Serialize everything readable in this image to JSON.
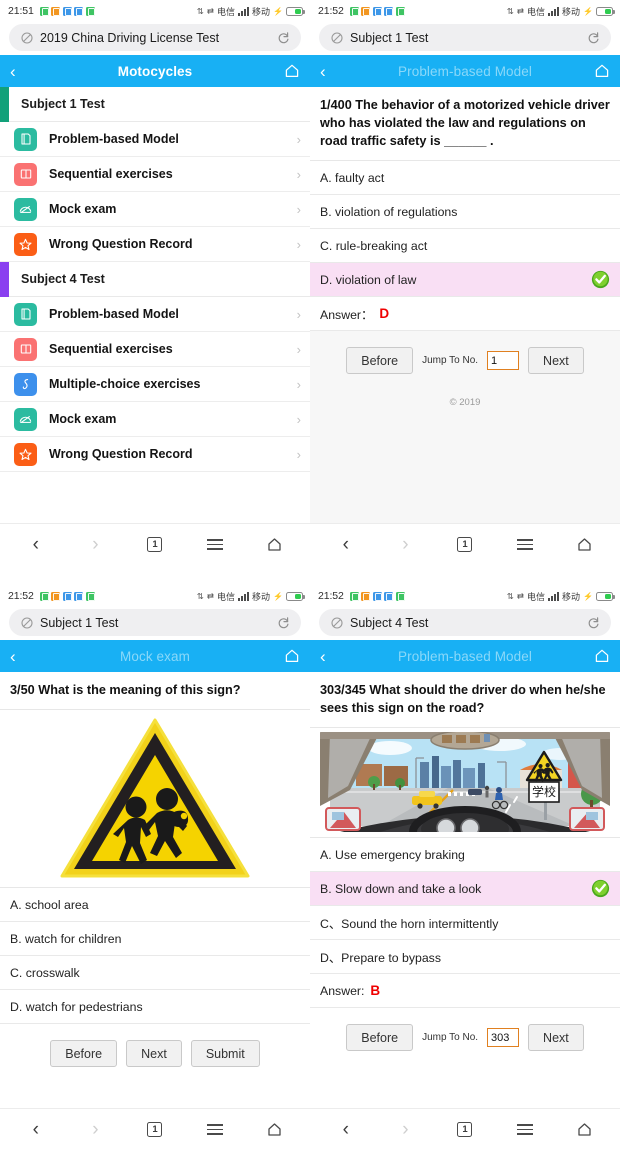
{
  "statusbar": {
    "time_1": "21:51",
    "time_2": "21:52",
    "carrier_left": "电信",
    "carrier_right": "移动",
    "app_badge_colors": [
      "#3ec463",
      "#f29620",
      "#3d97e8",
      "#3d97e8",
      "#3ec463"
    ],
    "battery_color": "#2fcc4f"
  },
  "theme": {
    "header_blue": "#18b0f4",
    "header_title_faded": "#8ad8f9",
    "correct_row_pink": "#f9dff4",
    "answer_red": "#ef0000",
    "input_border_orange": "#e08020",
    "subject1_accent": "#12a17a",
    "subject4_accent": "#8a3ff0"
  },
  "panels": [
    {
      "id": "panel-menu",
      "url_bar": {
        "value": "2019 China Driving License Test",
        "left_icon": "no-security-icon",
        "right_icon": "reload-icon"
      },
      "header": {
        "title": "Motocycles",
        "faded": false
      },
      "sections": [
        {
          "title": "Subject 1 Test",
          "accent": "#12a17a",
          "items": [
            {
              "label": "Problem-based Model",
              "icon": "book-stack-icon",
              "color": "#2bbba0"
            },
            {
              "label": "Sequential exercises",
              "icon": "open-book-icon",
              "color": "#fa7272"
            },
            {
              "label": "Mock exam",
              "icon": "gauge-icon",
              "color": "#2bbba0"
            },
            {
              "label": "Wrong Question Record",
              "icon": "star-icon",
              "color": "#fb5e16"
            }
          ]
        },
        {
          "title": "Subject 4 Test",
          "accent": "#8a3ff0",
          "items": [
            {
              "label": "Problem-based Model",
              "icon": "book-stack-icon",
              "color": "#2bbba0"
            },
            {
              "label": "Sequential exercises",
              "icon": "open-book-icon",
              "color": "#fa7272"
            },
            {
              "label": "Multiple-choice exercises",
              "icon": "multi-choice-icon",
              "color": "#3d90ec"
            },
            {
              "label": "Mock exam",
              "icon": "gauge-icon",
              "color": "#2bbba0"
            },
            {
              "label": "Wrong Question Record",
              "icon": "star-icon",
              "color": "#fb5e16"
            }
          ]
        }
      ]
    },
    {
      "id": "panel-subject1-problem",
      "url_bar": {
        "value": "Subject 1 Test",
        "left_icon": "no-security-icon",
        "right_icon": "reload-icon"
      },
      "header": {
        "title": "Problem-based Model",
        "faded": true
      },
      "question": {
        "number": "1/400",
        "text": "1/400 The behavior of a motorized vehicle driver who has violated the law and regulations on road traffic safety is ______ ."
      },
      "options": [
        {
          "label": "A. faulty act",
          "correct": false
        },
        {
          "label": "B. violation of regulations",
          "correct": false
        },
        {
          "label": "C. rule-breaking act",
          "correct": false
        },
        {
          "label": "D. violation of law",
          "correct": true
        }
      ],
      "answer_label": "Answer：",
      "answer_value": "D",
      "nav": {
        "before": "Before",
        "jump_label": "Jump To No.",
        "jump_value": "1",
        "next": "Next",
        "copyright": "© 2019"
      }
    },
    {
      "id": "panel-mock-exam",
      "url_bar": {
        "value": "Subject 1 Test",
        "left_icon": "no-security-icon",
        "right_icon": "reload-icon"
      },
      "header": {
        "title": "Mock exam",
        "faded": true
      },
      "question": {
        "number": "3/50",
        "text": "3/50 What is the meaning of this sign?",
        "image": "yellow-triangle-children-crossing-sign"
      },
      "options": [
        {
          "label": "A. school area",
          "correct": false
        },
        {
          "label": "B. watch for children",
          "correct": false
        },
        {
          "label": "C. crosswalk",
          "correct": false
        },
        {
          "label": "D. watch for pedestrians",
          "correct": false
        }
      ],
      "nav": {
        "before": "Before",
        "next": "Next",
        "submit": "Submit"
      }
    },
    {
      "id": "panel-subject4-problem",
      "url_bar": {
        "value": "Subject 4 Test",
        "left_icon": "no-security-icon",
        "right_icon": "reload-icon"
      },
      "header": {
        "title": "Problem-based Model",
        "faded": true
      },
      "question": {
        "number": "303/345",
        "text": "303/345 What should the driver do when he/she sees this sign on the road?",
        "image": "driver-pov-road-school-zone-sign"
      },
      "options": [
        {
          "label": "A. Use emergency braking",
          "correct": false
        },
        {
          "label": "B. Slow down and take a look",
          "correct": true
        },
        {
          "label": "C、Sound the horn intermittently",
          "correct": false
        },
        {
          "label": "D、Prepare to bypass",
          "correct": false
        }
      ],
      "answer_label": "Answer:",
      "answer_value": "B",
      "nav": {
        "before": "Before",
        "jump_label": "Jump To No.",
        "jump_value": "303",
        "next": "Next"
      }
    }
  ],
  "browser_nav": {
    "back": "back-chevron",
    "forward": "forward-chevron",
    "tabs_count": "1",
    "menu": "hamburger-menu",
    "home": "home-icon"
  }
}
